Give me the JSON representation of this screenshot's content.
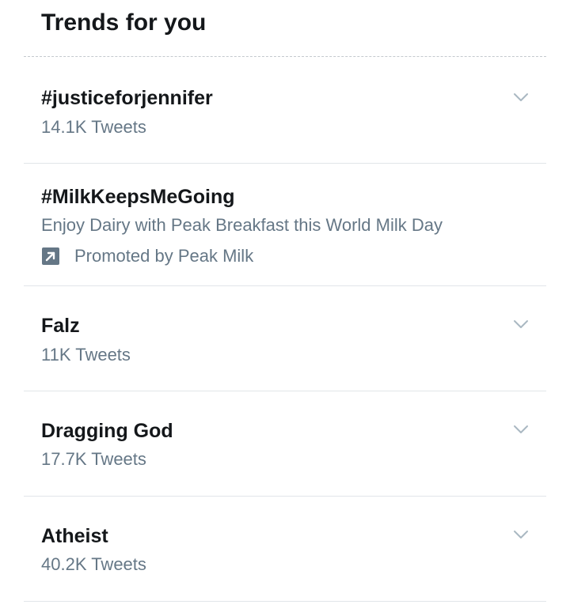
{
  "header": {
    "title": "Trends for you"
  },
  "trends": [
    {
      "name": "#justiceforjennifer",
      "meta": "14.1K Tweets",
      "icon": "chevron-down-icon"
    },
    {
      "name": "#MilkKeepsMeGoing",
      "meta": "Enjoy Dairy with Peak Breakfast this World Milk Day",
      "promoted": "Promoted by Peak Milk",
      "icon": "promoted-icon"
    },
    {
      "name": "Falz",
      "meta": "11K Tweets",
      "icon": "chevron-down-icon"
    },
    {
      "name": "Dragging God",
      "meta": "17.7K Tweets",
      "icon": "chevron-down-icon"
    },
    {
      "name": "Atheist",
      "meta": "40.2K Tweets",
      "icon": "chevron-down-icon"
    }
  ],
  "colors": {
    "text_primary": "#14171a",
    "text_secondary": "#657786",
    "divider": "#e1e5e9",
    "chevron": "#aab8c2",
    "promo_icon": "#657786"
  }
}
